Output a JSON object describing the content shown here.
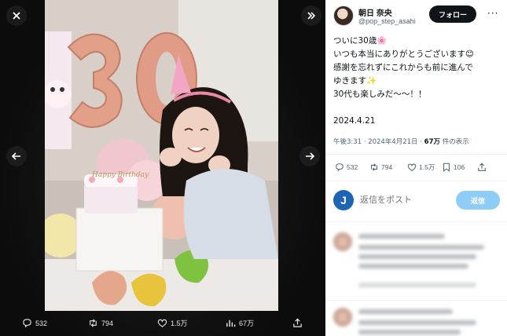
{
  "viewer": {
    "stats": {
      "replies": "532",
      "retweets": "794",
      "likes": "1.5万",
      "views": "67万"
    }
  },
  "photo": {
    "balloon_number": "30",
    "cake_topper": "Happy Birthday"
  },
  "author": {
    "name": "朝日 奈央",
    "handle": "@pop_step_asahi",
    "follow_label": "フォロー"
  },
  "tweet": {
    "lines": [
      "ついに30歳🌸",
      "いつも本当にありがとうございます😊",
      "感謝を忘れずにこれからも前に進んで",
      "ゆきます✨",
      "30代も楽しみだ〜〜！！"
    ],
    "date": "2024.4.21",
    "meta_time": "午後3:31 · 2024年4月21日 · ",
    "meta_views": "67万",
    "meta_views_suffix": " 件の表示"
  },
  "actions": {
    "replies": "532",
    "retweets": "794",
    "likes": "1.5万",
    "bookmarks": "106"
  },
  "reply_box": {
    "logo_letter": "J",
    "placeholder": "返信をポスト",
    "button_label": "返信"
  },
  "colors": {
    "follow_bg": "#0f1419",
    "reply_btn": "#8ecdf7",
    "reply_logo": "#1d64b4"
  }
}
